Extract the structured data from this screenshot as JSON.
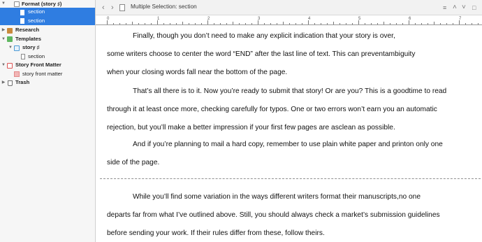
{
  "binder": {
    "items": [
      {
        "label": "Format (story ♯)",
        "bold": true
      },
      {
        "label": "section"
      },
      {
        "label": "section"
      },
      {
        "label": "Research",
        "bold": true
      },
      {
        "label": "Templates",
        "bold": true
      },
      {
        "label": "story ♯",
        "bold": true
      },
      {
        "label": "section"
      },
      {
        "label": "Story Front Matter",
        "bold": true
      },
      {
        "label": "story front matter"
      },
      {
        "label": "Trash",
        "bold": true
      }
    ]
  },
  "header": {
    "title_prefix": "Multiple Selection:",
    "title": "section",
    "back_icon": "‹",
    "forward_icon": "›",
    "menu_icon": "≡",
    "up_icon": "˄",
    "down_icon": "˅",
    "split_icon": "□"
  },
  "ruler": {
    "labels": [
      "0",
      "1",
      "2",
      "3",
      "4",
      "5",
      "6",
      "7"
    ]
  },
  "editor": {
    "paragraph1": [
      "Finally, though you don’t need to make any explicit indication that your story is over,",
      "some writers choose to center the word “END” after the last line of text. This can preventambiguity",
      "when your closing words fall near the bottom of the page."
    ],
    "paragraph2": [
      "That’s all there is to it. Now you’re ready to submit that story! Or are you? This is a goodtime to read",
      "through it at least once more, checking carefully for typos. One or two errors won’t earn you an automatic",
      "rejection, but you’ll make a better impression if your first few pages are asclean as possible."
    ],
    "paragraph3": [
      "And if you’re planning to mail a hard copy, remember to use plain white paper and printon only one",
      "side of the page."
    ],
    "paragraph4": [
      "While you’ll find some variation in the ways different writers format their manuscripts,no one",
      "departs far from what I’ve outlined above. Still, you should always check a market’s submission guidelines",
      "before sending your work. If their rules differ from these, follow theirs."
    ]
  }
}
